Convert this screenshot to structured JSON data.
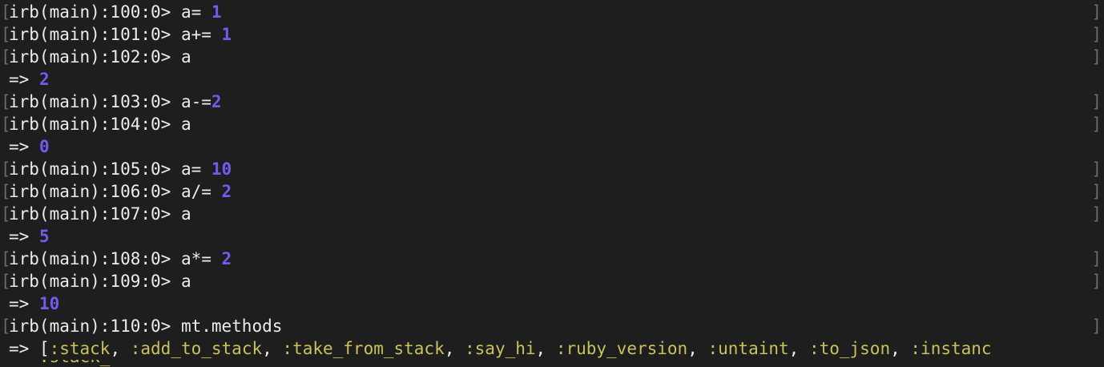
{
  "terminal": {
    "lines": [
      {
        "prompt": "irb(main):100:0> ",
        "code": "a= ",
        "value": "1"
      },
      {
        "prompt": "irb(main):101:0> ",
        "code": "a+= ",
        "value": "1"
      },
      {
        "prompt": "irb(main):102:0> ",
        "code": "a"
      },
      {
        "result_arrow": "=> ",
        "result": "2"
      },
      {
        "prompt": "irb(main):103:0> ",
        "code": "a-=",
        "value": "2"
      },
      {
        "prompt": "irb(main):104:0> ",
        "code": "a"
      },
      {
        "result_arrow": "=> ",
        "result": "0"
      },
      {
        "prompt": "irb(main):105:0> ",
        "code": "a= ",
        "value": "10"
      },
      {
        "prompt": "irb(main):106:0> ",
        "code": "a/= ",
        "value": "2"
      },
      {
        "prompt": "irb(main):107:0> ",
        "code": "a"
      },
      {
        "result_arrow": "=> ",
        "result": "5"
      },
      {
        "prompt": "irb(main):108:0> ",
        "code": "a*= ",
        "value": "2"
      },
      {
        "prompt": "irb(main):109:0> ",
        "code": "a"
      },
      {
        "result_arrow": "=> ",
        "result": "10"
      },
      {
        "prompt": "irb(main):110:0> ",
        "code": "mt.methods"
      }
    ],
    "methods_line": {
      "arrow": "=> ",
      "open": "[",
      "symbols": [
        ":stack",
        ":add_to_stack",
        ":take_from_stack",
        ":say_hi",
        ":ruby_version",
        ":untaint",
        ":to_json"
      ],
      "tail": ":instanc",
      "sep": ", "
    },
    "colors": {
      "background": "#1e1e1e",
      "text": "#ececec",
      "number": "#6f5cf0",
      "symbol": "#c9c25a",
      "bracket": "#6a6a6a"
    }
  }
}
